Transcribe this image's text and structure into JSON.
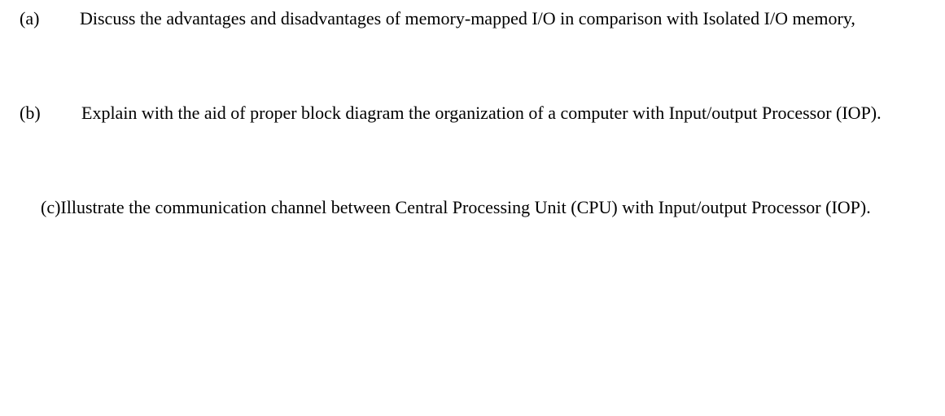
{
  "questions": [
    {
      "label": "(a)",
      "text": "Discuss the advantages and disadvantages of memory-mapped I/O in comparison with Isolated I/O memory,"
    },
    {
      "label": "(b)",
      "text": "Explain with the aid of proper block diagram the organization of a computer with Input/output  Processor (IOP)."
    },
    {
      "label": "(c)",
      "text": "Illustrate the communication channel between Central Processing Unit (CPU) with Input/output Processor (IOP)."
    }
  ]
}
